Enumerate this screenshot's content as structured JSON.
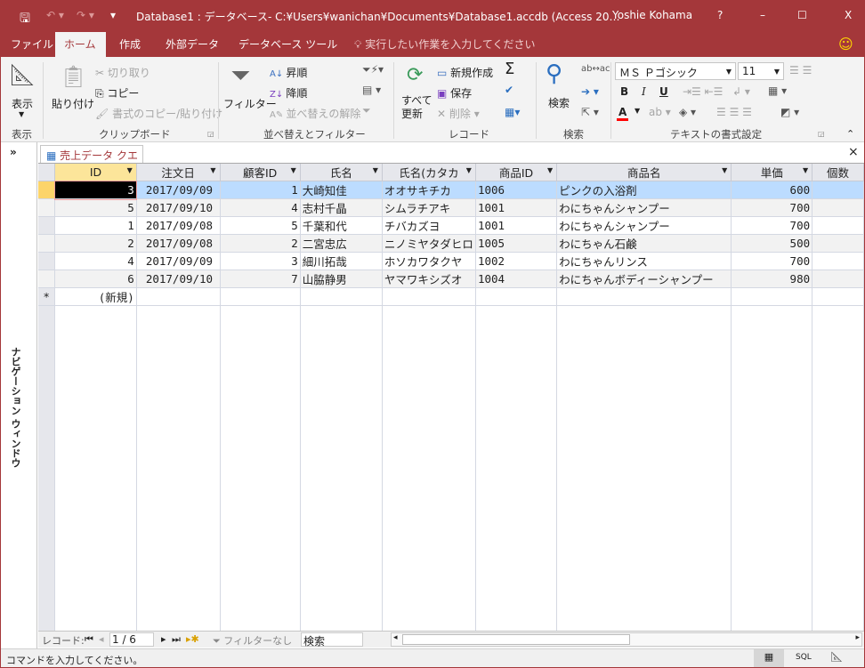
{
  "titlebar": {
    "title": "Database1 : データベース- C:¥Users¥wanichan¥Documents¥Database1.accdb (Access 20…",
    "user": "Yoshie Kohama",
    "help": "?",
    "minimize": "–",
    "maximize": "☐",
    "close": "X"
  },
  "tabs": [
    {
      "label": "ファイル"
    },
    {
      "label": "ホーム",
      "active": true
    },
    {
      "label": "作成"
    },
    {
      "label": "外部データ"
    },
    {
      "label": "データベース ツール"
    }
  ],
  "tell_me": "実行したい作業を入力してください",
  "ribbon": {
    "view": {
      "button": "表示",
      "group": "表示"
    },
    "clipboard": {
      "paste": "貼り付け",
      "cut": "切り取り",
      "copy": "コピー",
      "format_painter": "書式のコピー/貼り付け",
      "group": "クリップボード"
    },
    "sort_filter": {
      "filter": "フィルター",
      "ascending": "昇順",
      "descending": "降順",
      "remove_sort": "並べ替えの解除",
      "group": "並べ替えとフィルター"
    },
    "records": {
      "refresh_all": "すべて\n更新",
      "new": "新規作成",
      "save": "保存",
      "delete": "削除",
      "group": "レコード"
    },
    "find": {
      "find": "検索",
      "group": "検索"
    },
    "text_format": {
      "font": "ＭＳ Ｐゴシック",
      "size": "11",
      "bold": "B",
      "italic": "I",
      "underline": "U",
      "group": "テキストの書式設定",
      "font_color": "#ff0000"
    }
  },
  "nav_pane": {
    "label": "ナビゲーション ウィンドウ",
    "toggle": "»"
  },
  "document_tab": {
    "label": "売上データ クエリ",
    "close": "×"
  },
  "grid": {
    "columns": [
      "ID",
      "注文日",
      "顧客ID",
      "氏名",
      "氏名(カタカ",
      "商品ID",
      "商品名",
      "単価",
      "個数"
    ],
    "rows": [
      [
        "3",
        "2017/09/09",
        "1",
        "大崎知佳",
        "オオサキチカ",
        "1006",
        "ピンクの入浴剤",
        "600",
        ""
      ],
      [
        "5",
        "2017/09/10",
        "4",
        "志村千晶",
        "シムラチアキ",
        "1001",
        "わにちゃんシャンプー",
        "700",
        ""
      ],
      [
        "1",
        "2017/09/08",
        "5",
        "千葉和代",
        "チバカズヨ",
        "1001",
        "わにちゃんシャンプー",
        "700",
        ""
      ],
      [
        "2",
        "2017/09/08",
        "2",
        "二宮忠広",
        "ニノミヤタダヒロ",
        "1005",
        "わにちゃん石鹸",
        "500",
        ""
      ],
      [
        "4",
        "2017/09/09",
        "3",
        "細川拓哉",
        "ホソカワタクヤ",
        "1002",
        "わにちゃんリンス",
        "700",
        ""
      ],
      [
        "6",
        "2017/09/10",
        "7",
        "山脇静男",
        "ヤマワキシズオ",
        "1004",
        "わにちゃんボディーシャンプー",
        "980",
        ""
      ]
    ],
    "new_row_marker": "*",
    "new_row_label": "(新規)"
  },
  "record_nav": {
    "label": "レコード:",
    "position": "1 / 6",
    "filter": "フィルターなし",
    "search": "検索"
  },
  "status": {
    "text": "コマンドを入力してください。",
    "sql": "SQL"
  }
}
